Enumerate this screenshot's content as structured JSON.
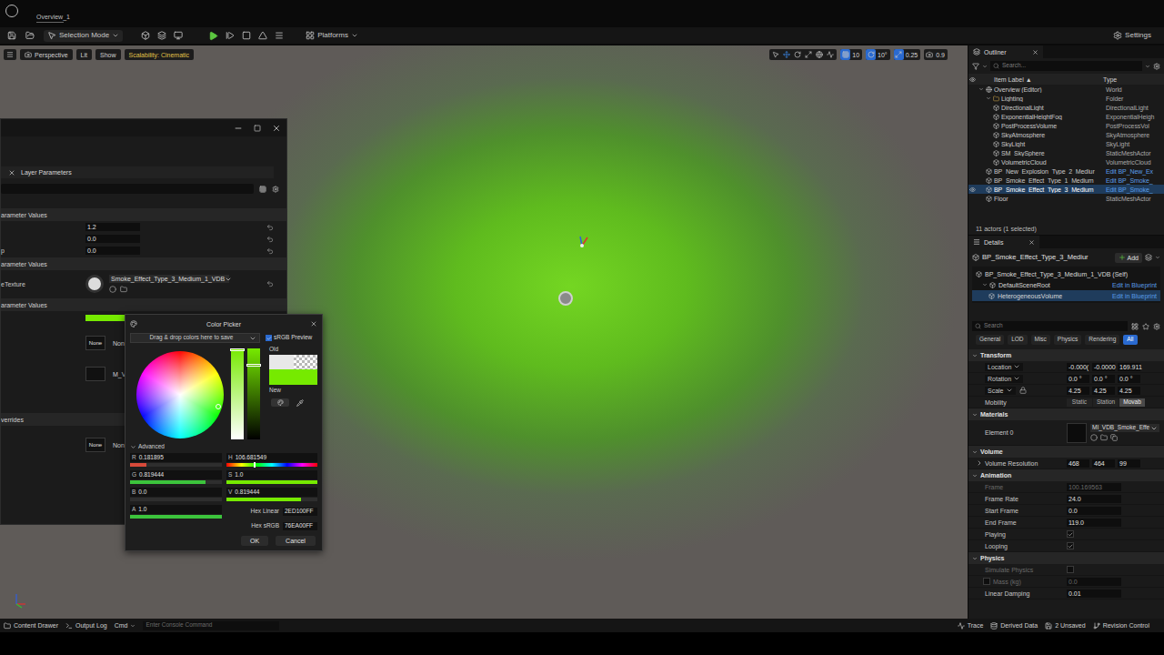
{
  "title_bar": {
    "tab": "Overview_1"
  },
  "toolbar": {
    "mode": "Selection Mode",
    "platforms": "Platforms",
    "settings": "Settings"
  },
  "viewport": {
    "menus": [
      "Perspective",
      "Lit",
      "Show"
    ],
    "scalability": "Scalability: Cinematic",
    "snaps": [
      {
        "value": "10",
        "on": true
      },
      {
        "value": "10°",
        "on": true
      },
      {
        "value": "0.25",
        "on": true
      },
      {
        "value": "0.9",
        "on": false
      }
    ]
  },
  "material_window": {
    "tab": "Layer Parameters",
    "rows": [
      {
        "kind": "header",
        "label": "arameter Values"
      },
      {
        "kind": "number",
        "label": "",
        "value": "1.2"
      },
      {
        "kind": "number",
        "label": "",
        "value": "0.0"
      },
      {
        "kind": "number",
        "label": "p",
        "value": "0.0"
      },
      {
        "kind": "header",
        "label": "arameter Values"
      },
      {
        "kind": "texture",
        "label": "eTexture",
        "value": "Smoke_Effect_Type_3_Medium_1_VDB"
      },
      {
        "kind": "header",
        "label": "arameter Values"
      },
      {
        "kind": "color",
        "label": "",
        "color": "#76EA00"
      },
      {
        "kind": "asset",
        "label": "",
        "thumb": "None",
        "value": "Non"
      },
      {
        "kind": "asset",
        "label": "",
        "thumb": "",
        "value": "M_V"
      },
      {
        "kind": "header",
        "label": "verrides"
      },
      {
        "kind": "asset",
        "label": "",
        "thumb": "None",
        "value": "Non"
      }
    ]
  },
  "color_picker": {
    "title": "Color Picker",
    "swatch_hint": "Drag & drop colors here to save",
    "srgb_preview": {
      "label": "sRGB Preview",
      "checked": true
    },
    "old_label": "Old",
    "new_label": "New",
    "old_color": "#E8E8E8",
    "new_color": "#76EA00",
    "advanced": {
      "label": "Advanced",
      "expanded": true
    },
    "channels": [
      {
        "name": "R",
        "value": "0.181895",
        "level": 0.18,
        "color": "#d84a3a"
      },
      {
        "name": "G",
        "value": "0.819444",
        "level": 0.82,
        "color": "#3cc43c"
      },
      {
        "name": "B",
        "value": "0.0",
        "level": 0.0,
        "color": "#3a8af0"
      },
      {
        "name": "A",
        "value": "1.0",
        "level": 1.0,
        "color": "#3cc43c"
      }
    ],
    "hsv": [
      {
        "name": "H",
        "value": "106.681549",
        "level": 0.296,
        "kind": "hue"
      },
      {
        "name": "S",
        "value": "1.0",
        "level": 1.0,
        "kind": "fill"
      },
      {
        "name": "V",
        "value": "0.819444",
        "level": 0.82,
        "kind": "fill"
      }
    ],
    "hex": [
      {
        "label": "Hex Linear",
        "value": "2ED100FF"
      },
      {
        "label": "Hex sRGB",
        "value": "76EA00FF"
      }
    ],
    "buttons": [
      "OK",
      "Cancel"
    ]
  },
  "outliner": {
    "title": "Outliner",
    "search": "Search...",
    "columns": [
      "Item Label ▲",
      "Type"
    ],
    "rows": [
      {
        "label": "Overview (Editor)",
        "type": "World",
        "depth": 0,
        "kind": "group",
        "expanded": true,
        "selected": false,
        "link": false
      },
      {
        "label": "Lighting",
        "type": "Folder",
        "depth": 1,
        "kind": "group",
        "expanded": true,
        "selected": false,
        "link": false
      },
      {
        "label": "DirectionalLight",
        "type": "DirectionalLight",
        "depth": 2,
        "kind": "item",
        "selected": false,
        "link": false
      },
      {
        "label": "ExponentialHeightFog",
        "type": "ExponentialHeigh",
        "depth": 2,
        "kind": "item",
        "selected": false,
        "link": false
      },
      {
        "label": "PostProcessVolume",
        "type": "PostProcessVol",
        "depth": 2,
        "kind": "item",
        "selected": false,
        "link": false
      },
      {
        "label": "SkyAtmosphere",
        "type": "SkyAtmosphere",
        "depth": 2,
        "kind": "item",
        "selected": false,
        "link": false
      },
      {
        "label": "SkyLight",
        "type": "SkyLight",
        "depth": 2,
        "kind": "item",
        "selected": false,
        "link": false
      },
      {
        "label": "SM_SkySphere",
        "type": "StaticMeshActor",
        "depth": 2,
        "kind": "item",
        "selected": false,
        "link": false
      },
      {
        "label": "VolumetricCloud",
        "type": "VolumetricCloud",
        "depth": 2,
        "kind": "item",
        "selected": false,
        "link": false
      },
      {
        "label": "BP_New_Explosion_Type_2_Mediur",
        "type": "Edit BP_New_Ex",
        "depth": 1,
        "kind": "item",
        "selected": false,
        "link": true
      },
      {
        "label": "BP_Smoke_Effect_Type_1_Medium_",
        "type": "Edit BP_Smoke_",
        "depth": 1,
        "kind": "item",
        "selected": false,
        "link": true
      },
      {
        "label": "BP_Smoke_Effect_Type_3_Medium_",
        "type": "Edit BP_Smoke_",
        "depth": 1,
        "kind": "item",
        "selected": true,
        "link": true
      },
      {
        "label": "Floor",
        "type": "StaticMeshActor",
        "depth": 1,
        "kind": "item",
        "selected": false,
        "link": false
      }
    ],
    "footer": "11 actors (1 selected)"
  },
  "details": {
    "title": "Details",
    "actor": "BP_Smoke_Effect_Type_3_Mediur",
    "add": "Add",
    "components": [
      {
        "label": "BP_Smoke_Effect_Type_3_Medium_1_VDB (Self)",
        "action": "",
        "depth": 0,
        "selected": false
      },
      {
        "label": "DefaultSceneRoot",
        "action": "Edit in Blueprint",
        "depth": 1,
        "selected": false
      },
      {
        "label": "HeterogeneousVolume",
        "action": "Edit in Blueprint",
        "depth": 2,
        "selected": true
      }
    ],
    "search": "Search",
    "filters": [
      {
        "label": "General",
        "selected": false
      },
      {
        "label": "LOD",
        "selected": false
      },
      {
        "label": "Misc",
        "selected": false
      },
      {
        "label": "Physics",
        "selected": false
      },
      {
        "label": "Rendering",
        "selected": false
      },
      {
        "label": "All",
        "selected": true
      }
    ],
    "sections": [
      {
        "title": "Transform",
        "rows": [
          {
            "kind": "vector",
            "label": "Location",
            "dropdown": true,
            "locked": false,
            "expandable": false,
            "values": [
              "-0.000(",
              "-0.0000",
              "169.911"
            ]
          },
          {
            "kind": "vector",
            "label": "Rotation",
            "dropdown": true,
            "locked": false,
            "expandable": false,
            "values": [
              "0.0 °",
              "0.0 °",
              "0.0 °"
            ]
          },
          {
            "kind": "vector",
            "label": "Scale",
            "dropdown": true,
            "locked": true,
            "expandable": false,
            "values": [
              "4.25",
              "4.25",
              "4.25"
            ]
          },
          {
            "kind": "options",
            "label": "Mobility",
            "options": [
              {
                "label": "Static",
                "selected": false
              },
              {
                "label": "Station",
                "selected": false
              },
              {
                "label": "Movab",
                "selected": true
              }
            ]
          }
        ]
      },
      {
        "title": "Materials",
        "rows": [
          {
            "kind": "asset",
            "label": "Element 0",
            "value": "MI_VDB_Smoke_Effe"
          }
        ]
      },
      {
        "title": "Volume",
        "rows": [
          {
            "kind": "vector",
            "label": "Volume Resolution",
            "dropdown": false,
            "locked": false,
            "expandable": true,
            "values": [
              "468",
              "464",
              "99"
            ]
          }
        ]
      },
      {
        "title": "Animation",
        "rows": [
          {
            "kind": "number",
            "label": "Frame",
            "value": "100.169563",
            "disabled": true
          },
          {
            "kind": "number",
            "label": "Frame Rate",
            "value": "24.0",
            "disabled": false
          },
          {
            "kind": "number",
            "label": "Start Frame",
            "value": "0.0",
            "disabled": false
          },
          {
            "kind": "number",
            "label": "End Frame",
            "value": "119.0",
            "disabled": false
          },
          {
            "kind": "check",
            "label": "Playing",
            "checked": true,
            "disabled": false
          },
          {
            "kind": "check",
            "label": "Looping",
            "checked": true,
            "disabled": false
          }
        ]
      },
      {
        "title": "Physics",
        "rows": [
          {
            "kind": "check",
            "label": "Simulate Physics",
            "checked": false,
            "disabled": true
          },
          {
            "kind": "check_number",
            "label": "Mass (kg)",
            "value": "0.0",
            "checked": false,
            "disabled": true
          },
          {
            "kind": "number",
            "label": "Linear Damping",
            "value": "0.01",
            "disabled": false
          }
        ]
      }
    ]
  },
  "status_bar": {
    "left": [
      "Content Drawer",
      "Output Log",
      "Cmd"
    ],
    "console_placeholder": "Enter Console Command",
    "right": [
      "Trace",
      "Derived Data",
      "2 Unsaved",
      "Revision Control"
    ]
  }
}
